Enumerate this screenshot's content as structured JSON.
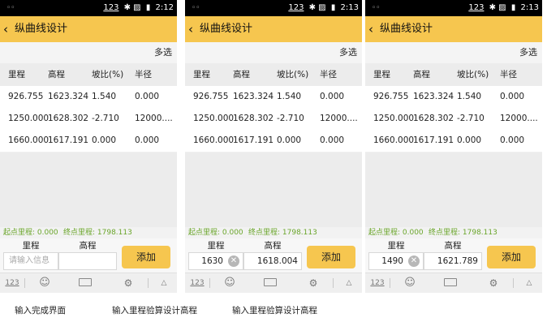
{
  "screens": [
    {
      "status": {
        "left_icon": "◦◦",
        "keyboard": "123",
        "icons": "✱ ▨",
        "battery": "▮",
        "time": "2:12"
      },
      "title": "纵曲线设计",
      "multi_select": "多选",
      "columns": [
        "里程",
        "高程",
        "坡比(%)",
        "半径"
      ],
      "rows": [
        [
          "926.755",
          "1623.324",
          "1.540",
          "0.000"
        ],
        [
          "1250.000",
          "1628.302",
          "-2.710",
          "12000...."
        ],
        [
          "1660.000",
          "1617.191",
          "0.000",
          "0.000"
        ]
      ],
      "info": {
        "start": "起点里程: 0.000",
        "end": "终点里程: 1798.113"
      },
      "input": {
        "col1_label": "里程",
        "col2_label": "高程",
        "placeholder": "请输入信息",
        "mileage_value": "",
        "elevation_value": ""
      },
      "add_label": "添加",
      "keyboard_bar": {
        "num_label": "123",
        "emoji": "☺",
        "settings": "⚙",
        "collapse": "△"
      },
      "caption": "输入完成界面"
    },
    {
      "status": {
        "left_icon": "◦◦",
        "keyboard": "123",
        "icons": "✱ ▨",
        "battery": "▮",
        "time": "2:13"
      },
      "title": "纵曲线设计",
      "multi_select": "多选",
      "columns": [
        "里程",
        "高程",
        "坡比(%)",
        "半径"
      ],
      "rows": [
        [
          "926.755",
          "1623.324",
          "1.540",
          "0.000"
        ],
        [
          "1250.000",
          "1628.302",
          "-2.710",
          "12000...."
        ],
        [
          "1660.000",
          "1617.191",
          "0.000",
          "0.000"
        ]
      ],
      "info": {
        "start": "起点里程: 0.000",
        "end": "终点里程: 1798.113"
      },
      "input": {
        "col1_label": "里程",
        "col2_label": "高程",
        "placeholder": "",
        "mileage_value": "1630",
        "elevation_value": "1618.004"
      },
      "add_label": "添加",
      "keyboard_bar": {
        "num_label": "123",
        "emoji": "☺",
        "settings": "⚙",
        "collapse": "△"
      },
      "caption": "输入里程验算设计高程"
    },
    {
      "status": {
        "left_icon": "◦◦",
        "keyboard": "123",
        "icons": "✱ ▨",
        "battery": "▮",
        "time": "2:13"
      },
      "title": "纵曲线设计",
      "multi_select": "多选",
      "columns": [
        "里程",
        "高程",
        "坡比(%)",
        "半径"
      ],
      "rows": [
        [
          "926.755",
          "1623.324",
          "1.540",
          "0.000"
        ],
        [
          "1250.000",
          "1628.302",
          "-2.710",
          "12000...."
        ],
        [
          "1660.000",
          "1617.191",
          "0.000",
          "0.000"
        ]
      ],
      "info": {
        "start": "起点里程: 0.000",
        "end": "终点里程: 1798.113"
      },
      "input": {
        "col1_label": "里程",
        "col2_label": "高程",
        "placeholder": "",
        "mileage_value": "1490",
        "elevation_value": "1621.789"
      },
      "add_label": "添加",
      "keyboard_bar": {
        "num_label": "123",
        "emoji": "☺",
        "settings": "⚙",
        "collapse": "△"
      },
      "caption": "输入里程验算设计高程"
    }
  ],
  "colors": {
    "accent": "#f6c64f",
    "info_text": "#6aa52a",
    "status_bar": "#000000"
  }
}
